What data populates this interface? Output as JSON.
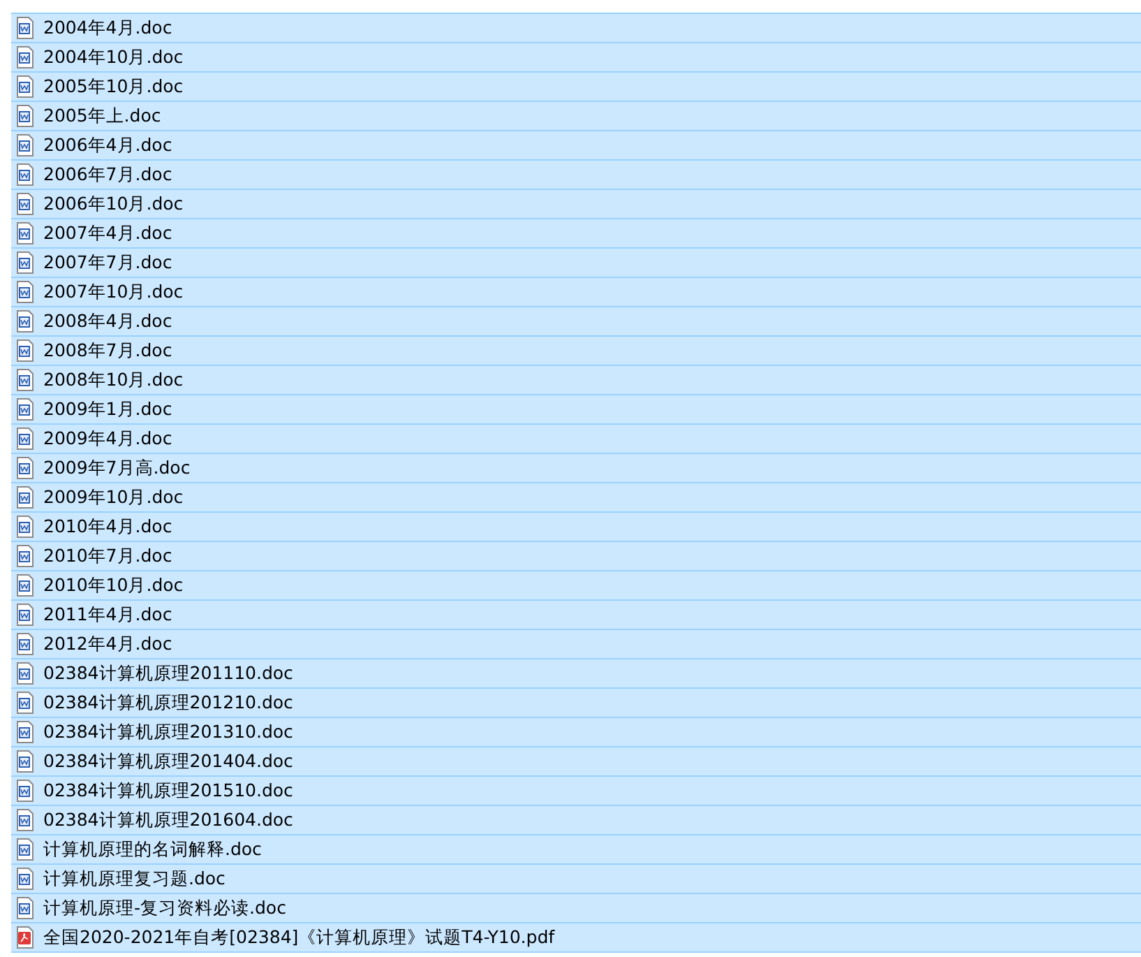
{
  "files": [
    {
      "name": "2004年4月.doc",
      "kind": "doc",
      "selected": true
    },
    {
      "name": "2004年10月.doc",
      "kind": "doc",
      "selected": true
    },
    {
      "name": "2005年10月.doc",
      "kind": "doc",
      "selected": true
    },
    {
      "name": "2005年上.doc",
      "kind": "doc",
      "selected": true
    },
    {
      "name": "2006年4月.doc",
      "kind": "doc",
      "selected": true
    },
    {
      "name": "2006年7月.doc",
      "kind": "doc",
      "selected": true
    },
    {
      "name": "2006年10月.doc",
      "kind": "doc",
      "selected": true
    },
    {
      "name": "2007年4月.doc",
      "kind": "doc",
      "selected": true
    },
    {
      "name": "2007年7月.doc",
      "kind": "doc",
      "selected": true
    },
    {
      "name": "2007年10月.doc",
      "kind": "doc",
      "selected": true
    },
    {
      "name": "2008年4月.doc",
      "kind": "doc",
      "selected": true
    },
    {
      "name": "2008年7月.doc",
      "kind": "doc",
      "selected": true
    },
    {
      "name": "2008年10月.doc",
      "kind": "doc",
      "selected": true
    },
    {
      "name": "2009年1月.doc",
      "kind": "doc",
      "selected": true
    },
    {
      "name": "2009年4月.doc",
      "kind": "doc",
      "selected": true
    },
    {
      "name": "2009年7月高.doc",
      "kind": "doc",
      "selected": true
    },
    {
      "name": "2009年10月.doc",
      "kind": "doc",
      "selected": true
    },
    {
      "name": "2010年4月.doc",
      "kind": "doc",
      "selected": true
    },
    {
      "name": "2010年7月.doc",
      "kind": "doc",
      "selected": true
    },
    {
      "name": "2010年10月.doc",
      "kind": "doc",
      "selected": true
    },
    {
      "name": "2011年4月.doc",
      "kind": "doc",
      "selected": true
    },
    {
      "name": "2012年4月.doc",
      "kind": "doc",
      "selected": true
    },
    {
      "name": "02384计算机原理201110.doc",
      "kind": "doc",
      "selected": true
    },
    {
      "name": "02384计算机原理201210.doc",
      "kind": "doc",
      "selected": true
    },
    {
      "name": "02384计算机原理201310.doc",
      "kind": "doc",
      "selected": true
    },
    {
      "name": "02384计算机原理201404.doc",
      "kind": "doc",
      "selected": true
    },
    {
      "name": "02384计算机原理201510.doc",
      "kind": "doc",
      "selected": true
    },
    {
      "name": "02384计算机原理201604.doc",
      "kind": "doc",
      "selected": true
    },
    {
      "name": "计算机原理的名词解释.doc",
      "kind": "doc",
      "selected": true
    },
    {
      "name": "计算机原理复习题.doc",
      "kind": "doc",
      "selected": true
    },
    {
      "name": "计算机原理-复习资料必读.doc",
      "kind": "doc",
      "selected": true
    },
    {
      "name": "全国2020-2021年自考[02384]《计算机原理》试题T4-Y10.pdf",
      "kind": "pdf",
      "selected": true
    }
  ]
}
